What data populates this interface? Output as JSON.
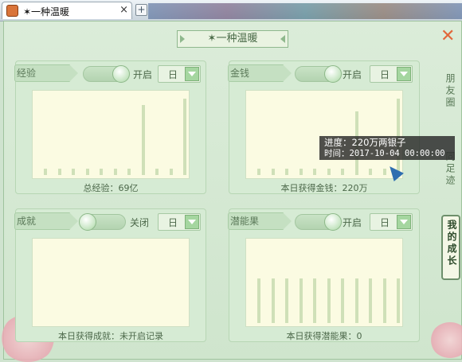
{
  "browser": {
    "tab_title": "✶一种温暖",
    "close_symbol": "×",
    "new_tab_symbol": "+"
  },
  "window": {
    "title": "✶一种温暖",
    "close_symbol": "✕"
  },
  "side_tabs": [
    {
      "label": "朋友圈",
      "active": false
    },
    {
      "label": "同足迹",
      "active": false
    },
    {
      "label": "我的成长",
      "active": true
    }
  ],
  "sections": {
    "exp": {
      "label": "经验",
      "toggle_state": "on",
      "toggle_label": "开启",
      "period": "日",
      "footer": "总经验：69亿",
      "chart_data": {
        "type": "bar",
        "values": [
          1,
          1,
          1,
          1,
          1,
          1,
          1,
          11,
          1,
          1,
          12
        ]
      }
    },
    "gold": {
      "label": "金钱",
      "toggle_state": "on",
      "toggle_label": "开启",
      "period": "日",
      "footer": "本日获得金钱：220万",
      "chart_data": {
        "type": "bar",
        "values": [
          1,
          1,
          1,
          1,
          1,
          1,
          1,
          10,
          1,
          1,
          12
        ]
      }
    },
    "achievement": {
      "label": "成就",
      "toggle_state": "off",
      "toggle_label": "关闭",
      "period": "日",
      "footer": "本日获得成就：未开启记录",
      "chart_data": {
        "type": "bar",
        "values": []
      }
    },
    "potential": {
      "label": "潜能果",
      "toggle_state": "on",
      "toggle_label": "开启",
      "period": "日",
      "footer": "本日获得潜能果：0",
      "chart_data": {
        "type": "bar",
        "values": [
          7,
          7,
          7,
          7,
          7,
          7,
          7,
          7,
          7,
          7,
          7
        ]
      }
    }
  },
  "tooltip": {
    "line1": "进度：220万两银子",
    "line2": "时间：2017-10-04 00:00:00"
  },
  "colors": {
    "accent": "#a5d6a0",
    "close": "#e2683b",
    "plot_bg": "#fbfbe2",
    "bar": "#cfe0b8"
  }
}
